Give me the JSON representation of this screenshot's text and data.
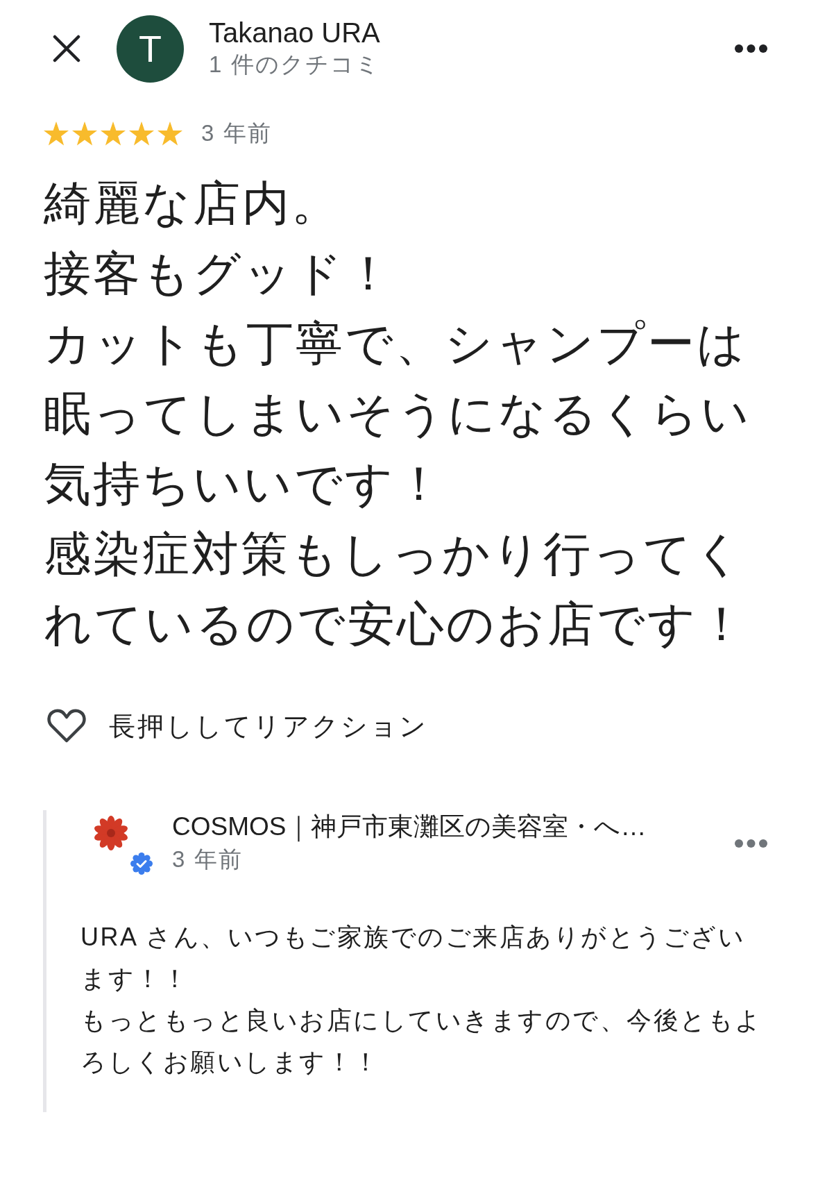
{
  "header": {
    "avatar_letter": "T",
    "name": "Takanao URA",
    "subtitle": "1 件のクチコミ"
  },
  "review": {
    "stars": 5,
    "time": "3 年前",
    "paragraphs": [
      "綺麗な店内。",
      "接客もグッド！",
      "カットも丁寧で、シャンプーは眠ってしまいそうになるくらい気持ちいいです！",
      "感染症対策もしっかり行ってくれているので安心のお店です！"
    ]
  },
  "reaction": {
    "label": "長押ししてリアクション"
  },
  "owner_reply": {
    "name": "COSMOS｜神戸市東灘区の美容室・へ…",
    "verified": true,
    "time": "3 年前",
    "paragraphs": [
      "URA さん、いつもご家族でのご来店ありがとうございます！！",
      "もっともっと良いお店にしていきますので、今後ともよろしくお願いします！！"
    ]
  }
}
